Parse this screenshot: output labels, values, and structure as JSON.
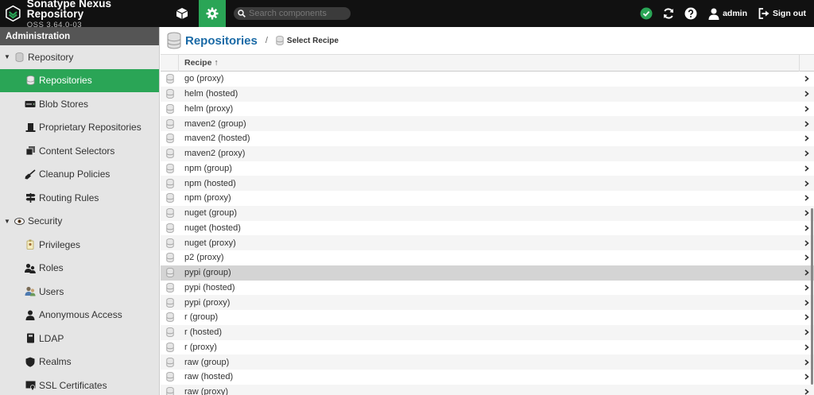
{
  "header": {
    "brand_title": "Sonatype Nexus Repository",
    "brand_version": "OSS 3.64.0-03",
    "search_placeholder": "Search components",
    "user_name": "admin",
    "sign_out_label": "Sign out"
  },
  "sidebar": {
    "heading": "Administration",
    "groups": [
      {
        "label": "Repository",
        "children": [
          {
            "label": "Repositories",
            "icon": "database-icon",
            "active": true
          },
          {
            "label": "Blob Stores",
            "icon": "server-icon"
          },
          {
            "label": "Proprietary Repositories",
            "icon": "hat-icon"
          },
          {
            "label": "Content Selectors",
            "icon": "layers-icon"
          },
          {
            "label": "Cleanup Policies",
            "icon": "broom-icon"
          },
          {
            "label": "Routing Rules",
            "icon": "signpost-icon"
          }
        ]
      },
      {
        "label": "Security",
        "children": [
          {
            "label": "Privileges",
            "icon": "badge-icon"
          },
          {
            "label": "Roles",
            "icon": "users-icon"
          },
          {
            "label": "Users",
            "icon": "user-group-icon"
          },
          {
            "label": "Anonymous Access",
            "icon": "user-icon"
          },
          {
            "label": "LDAP",
            "icon": "book-icon"
          },
          {
            "label": "Realms",
            "icon": "shield-icon"
          },
          {
            "label": "SSL Certificates",
            "icon": "certificate-icon"
          }
        ]
      }
    ]
  },
  "main": {
    "title": "Repositories",
    "breadcrumb_current": "Select Recipe",
    "column_recipe": "Recipe ↑",
    "recipes": [
      "go (proxy)",
      "helm (hosted)",
      "helm (proxy)",
      "maven2 (group)",
      "maven2 (hosted)",
      "maven2 (proxy)",
      "npm (group)",
      "npm (hosted)",
      "npm (proxy)",
      "nuget (group)",
      "nuget (hosted)",
      "nuget (proxy)",
      "p2 (proxy)",
      "pypi (group)",
      "pypi (hosted)",
      "pypi (proxy)",
      "r (group)",
      "r (hosted)",
      "r (proxy)",
      "raw (group)",
      "raw (hosted)",
      "raw (proxy)"
    ],
    "selected_recipe": "pypi (group)"
  },
  "colors": {
    "accent": "#2aa556",
    "header_bg": "#111111",
    "title_blue": "#1a6aa6"
  }
}
